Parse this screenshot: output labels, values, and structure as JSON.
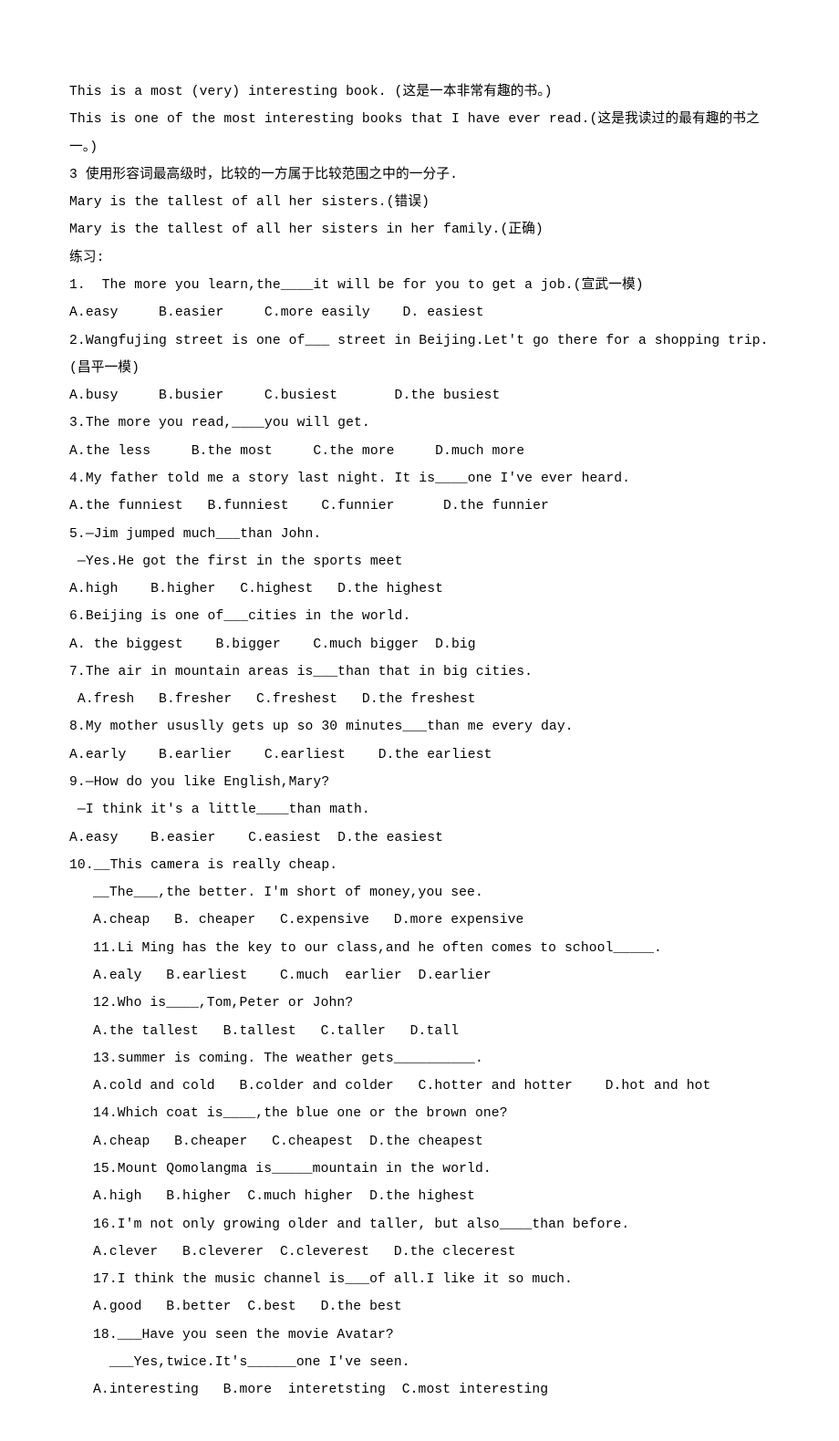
{
  "intro": {
    "l1": "This is a most (very) interesting book. (这是一本非常有趣的书。)",
    "l2": "This is one of the most interesting books that I have ever read.(这是我读过的最有趣的书之一。)",
    "l3": "3 使用形容词最高级时，比较的一方属于比较范围之中的一分子.",
    "l4": "Mary is the tallest of all her sisters.(错误)",
    "l5": "Mary is the tallest of all her sisters in her family.(正确)",
    "l6": "练习:"
  },
  "q1": {
    "stem": "1.  The more you learn,the____it will be for you to get a job.(宣武一模)",
    "opts": "A.easy     B.easier     C.more easily    D. easiest"
  },
  "q2": {
    "stem": "2.Wangfujing street is one of___ street in Beijing.Let't go there for a shopping trip.(昌平一模)",
    "opts": "A.busy     B.busier     C.busiest       D.the busiest"
  },
  "q3": {
    "stem": "3.The more you read,____you will get.",
    "opts": "A.the less     B.the most     C.the more     D.much more"
  },
  "q4": {
    "stem": "4.My father told me a story last night. It is____one I've ever heard.",
    "opts": "A.the funniest   B.funniest    C.funnier      D.the funnier"
  },
  "q5": {
    "stem": "5.—Jim jumped much___than John.",
    "sub": " —Yes.He got the first in the sports meet",
    "opts": "A.high    B.higher   C.highest   D.the highest"
  },
  "q6": {
    "stem": "6.Beijing is one of___cities in the world.",
    "opts": "A. the biggest    B.bigger    C.much bigger  D.big"
  },
  "q7": {
    "stem": "7.The air in mountain areas is___than that in big cities.",
    "opts": " A.fresh   B.fresher   C.freshest   D.the freshest"
  },
  "q8": {
    "stem": "8.My mother ususlly gets up so 30 minutes___than me every day.",
    "opts": "A.early    B.earlier    C.earliest    D.the earliest"
  },
  "q9": {
    "stem": "9.—How do you like English,Mary?",
    "sub": " —I think it's a little____than math.",
    "opts": "A.easy    B.easier    C.easiest  D.the easiest"
  },
  "q10": {
    "stem": "10.__This camera is really cheap.",
    "sub": "__The___,the better. I'm short of money,you see.",
    "opts": "A.cheap   B. cheaper   C.expensive   D.more expensive"
  },
  "q11": {
    "stem": "11.Li Ming has the key to our class,and he often comes to school_____.",
    "opts": "A.ealy   B.earliest    C.much  earlier  D.earlier"
  },
  "q12": {
    "stem": "12.Who is____,Tom,Peter or John?",
    "opts": "A.the tallest   B.tallest   C.taller   D.tall"
  },
  "q13": {
    "stem": "13.summer is coming. The weather gets__________.",
    "opts": "A.cold and cold   B.colder and colder   C.hotter and hotter    D.hot and hot"
  },
  "q14": {
    "stem": "14.Which coat is____,the blue one or the brown one?",
    "opts": "A.cheap   B.cheaper   C.cheapest  D.the cheapest"
  },
  "q15": {
    "stem": "15.Mount Qomolangma is_____mountain in the world.",
    "opts": "A.high   B.higher  C.much higher  D.the highest"
  },
  "q16": {
    "stem": "16.I'm not only growing older and taller, but also____than before.",
    "opts": "A.clever   B.cleverer  C.cleverest   D.the clecerest"
  },
  "q17": {
    "stem": "17.I think the music channel is___of all.I like it so much.",
    "opts": "A.good   B.better  C.best   D.the best"
  },
  "q18": {
    "stem": "18.___Have you seen the movie Avatar?",
    "sub": "  ___Yes,twice.It's______one I've seen.",
    "opts": "A.interesting   B.more  interetsting  C.most interesting"
  }
}
